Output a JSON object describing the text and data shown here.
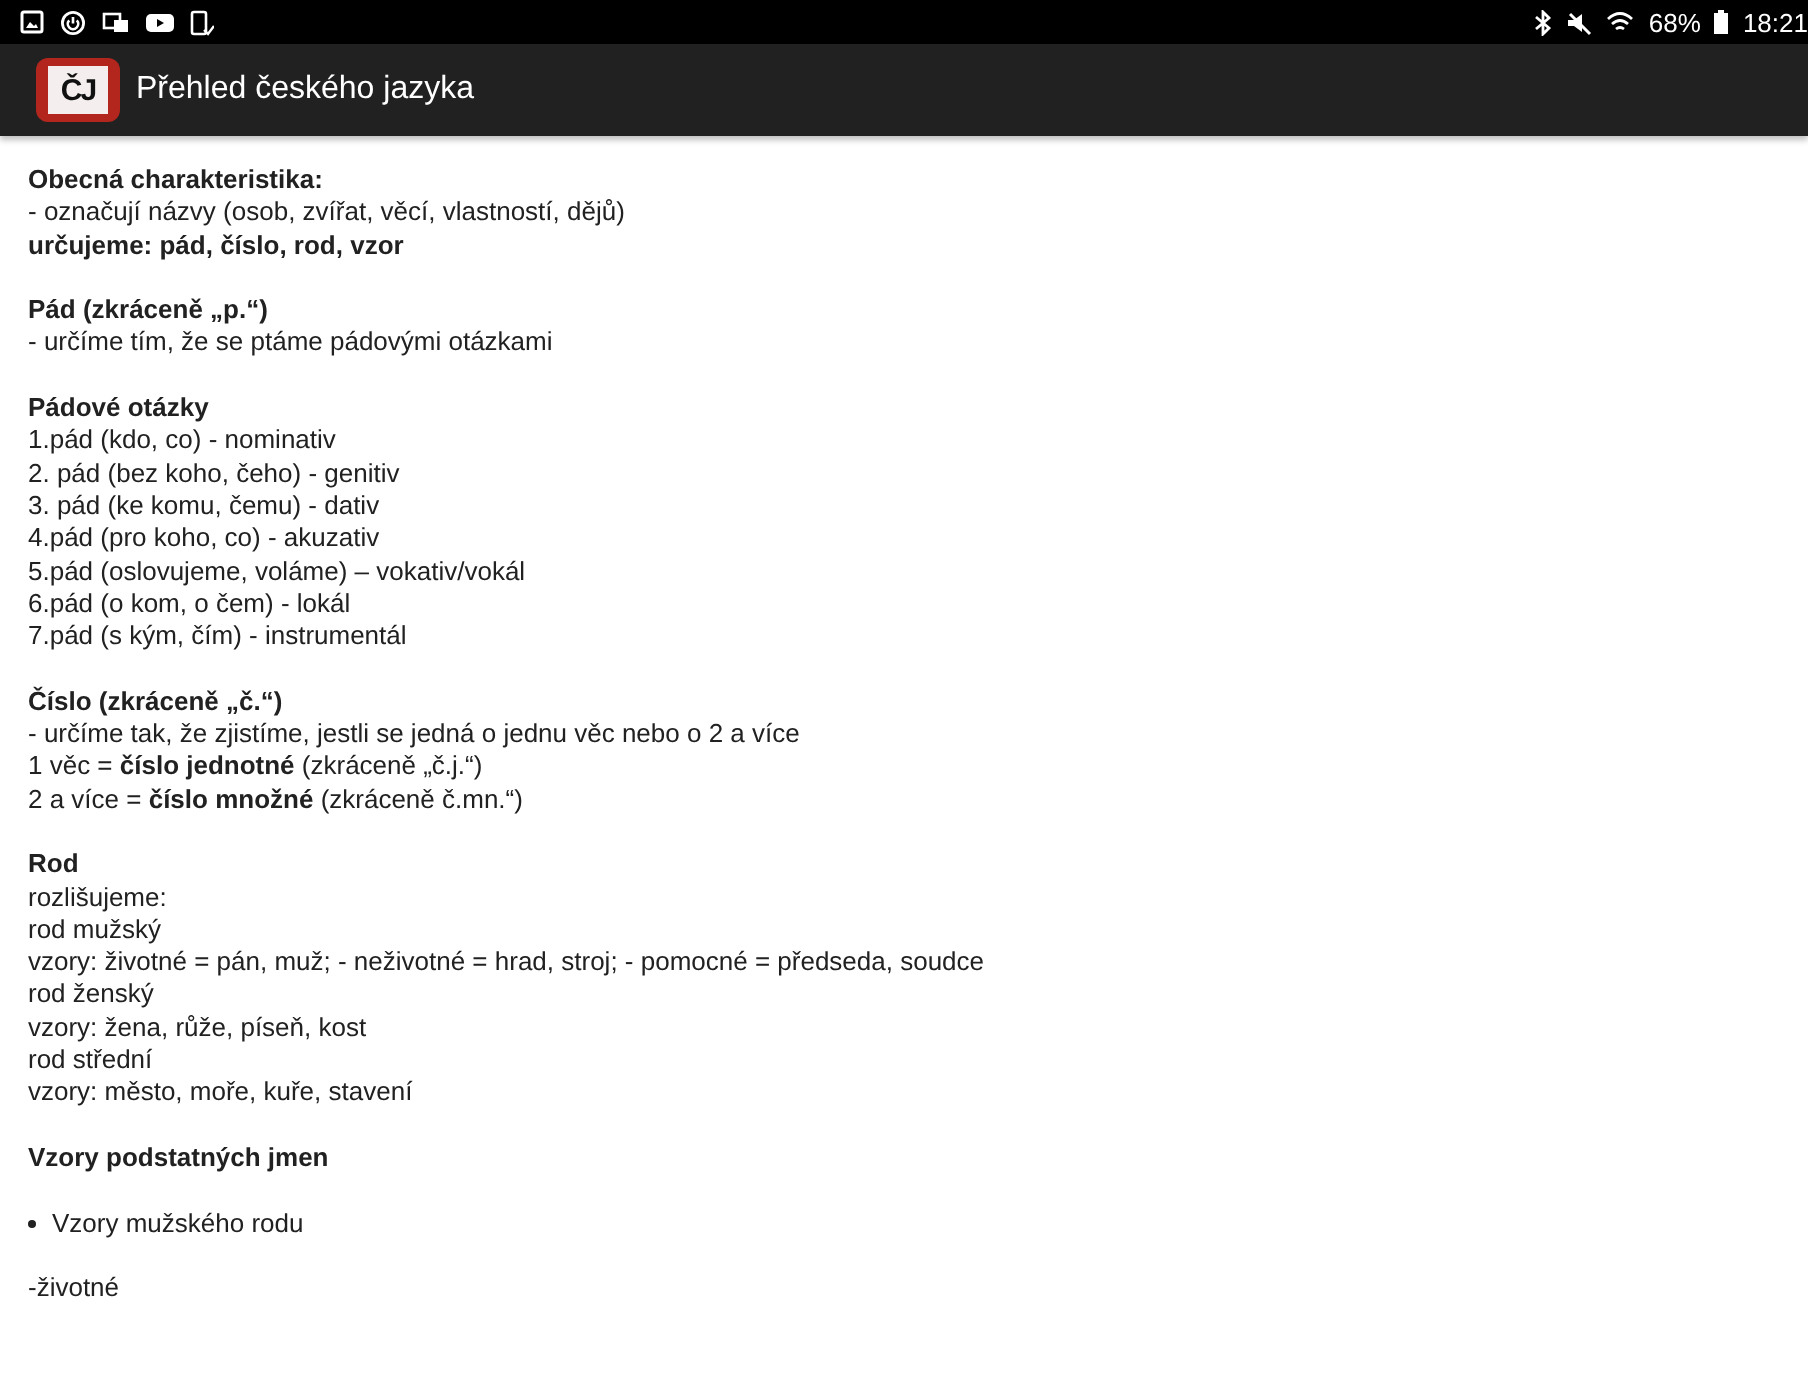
{
  "status_bar": {
    "battery": "68%",
    "time": "18:21"
  },
  "app_bar": {
    "logo_text": "ČJ",
    "title": "Přehled českého jazyka"
  },
  "blocks": [
    {
      "lines": [
        {
          "kind": "bold",
          "text": "Obecná charakteristika:"
        },
        {
          "kind": "text",
          "text": "- označují názvy (osob, zvířat, věcí, vlastností, dějů)"
        },
        {
          "kind": "bold",
          "text": "určujeme: pád, číslo, rod, vzor"
        }
      ]
    },
    {
      "lines": [
        {
          "kind": "bold",
          "text": "Pád (zkráceně „p.“)"
        },
        {
          "kind": "text",
          "text": "- určíme tím, že se ptáme pádovými otázkami"
        }
      ]
    },
    {
      "lines": [
        {
          "kind": "bold",
          "text": "Pádové otázky"
        },
        {
          "kind": "text",
          "text": "1.pád (kdo, co) - nominativ"
        },
        {
          "kind": "text",
          "text": "2. pád (bez koho, čeho) - genitiv"
        },
        {
          "kind": "text",
          "text": "3. pád (ke komu, čemu) - dativ"
        },
        {
          "kind": "text",
          "text": "4.pád (pro koho, co) - akuzativ"
        },
        {
          "kind": "text",
          "text": "5.pád (oslovujeme, voláme) – vokativ/vokál"
        },
        {
          "kind": "text",
          "text": "6.pád (o kom, o čem) - lokál"
        },
        {
          "kind": "text",
          "text": "7.pád (s kým, čím) - instrumentál"
        }
      ]
    },
    {
      "lines": [
        {
          "kind": "bold",
          "text": "Číslo (zkráceně „č.“)"
        },
        {
          "kind": "text",
          "text": "- určíme tak, že zjistíme, jestli se jedná o jednu věc nebo o 2 a více"
        },
        {
          "kind": "text",
          "text": "1 věc = **číslo jednotné** (zkráceně „č.j.“)"
        },
        {
          "kind": "text",
          "text": "2 a více = **číslo množné** (zkráceně č.mn.“)"
        }
      ]
    },
    {
      "lines": [
        {
          "kind": "bold",
          "text": "Rod"
        },
        {
          "kind": "text",
          "text": "rozlišujeme:"
        },
        {
          "kind": "text",
          "text": "rod mužský"
        },
        {
          "kind": "text",
          "text": "vzory: životné = pán, muž; - neživotné = hrad, stroj; - pomocné = předseda, soudce"
        },
        {
          "kind": "text",
          "text": "rod ženský"
        },
        {
          "kind": "text",
          "text": "vzory: žena, růže, píseň, kost"
        },
        {
          "kind": "text",
          "text": "rod střední"
        },
        {
          "kind": "text",
          "text": "vzory: město, moře, kuře, stavení"
        }
      ]
    },
    {
      "lines": [
        {
          "kind": "bold",
          "text": "Vzory podstatných jmen"
        }
      ]
    },
    {
      "lines": [
        {
          "kind": "bullet",
          "text": "Vzory mužského rodu"
        }
      ]
    },
    {
      "lines": [
        {
          "kind": "text",
          "text": "-životné"
        }
      ]
    }
  ]
}
